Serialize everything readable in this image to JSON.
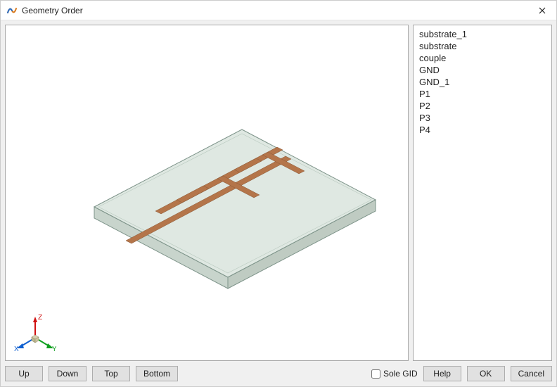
{
  "window": {
    "title": "Geometry Order"
  },
  "geometry_list": {
    "items": [
      "substrate_1",
      "substrate",
      "couple",
      "GND",
      "GND_1",
      "P1",
      "P2",
      "P3",
      "P4"
    ]
  },
  "buttons": {
    "up": "Up",
    "down": "Down",
    "top": "Top",
    "bottom": "Bottom",
    "help": "Help",
    "ok": "OK",
    "cancel": "Cancel"
  },
  "checkbox": {
    "sole_gid_label": "Sole GID",
    "sole_gid_checked": false
  },
  "triad": {
    "x_label": "X",
    "y_label": "Y",
    "z_label": "Z"
  },
  "colors": {
    "substrate_fill": "#c9d6cd",
    "substrate_edge": "#889a8c",
    "copper": "#b4754a",
    "triad_x": "#1060d0",
    "triad_y": "#10a020",
    "triad_z": "#d01010"
  }
}
